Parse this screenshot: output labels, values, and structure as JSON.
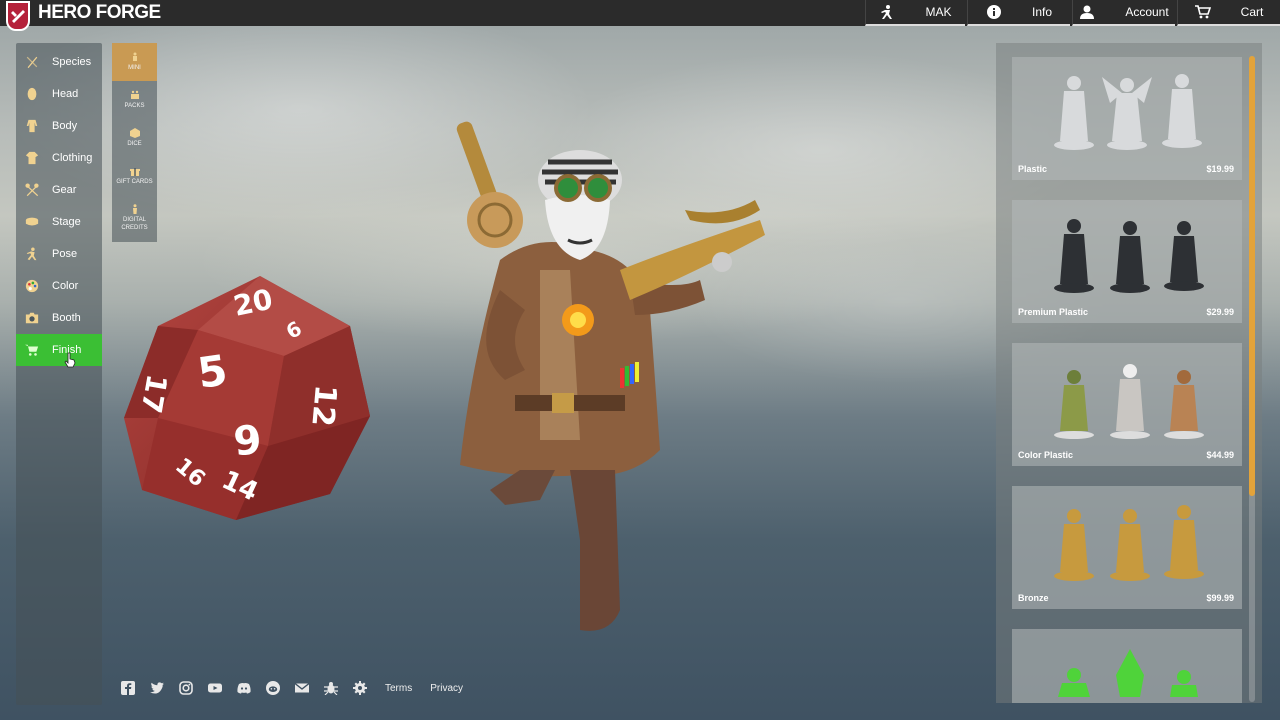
{
  "brand": {
    "name": "HERO FORGE",
    "logo_icon": "anvil-hammer-icon",
    "accent": "#b5213a"
  },
  "topnav": [
    {
      "label": "MAK",
      "icon": "hero-figure-icon"
    },
    {
      "label": "Info",
      "icon": "info-icon"
    },
    {
      "label": "Account",
      "icon": "user-icon"
    },
    {
      "label": "Cart",
      "icon": "cart-icon"
    }
  ],
  "sidebar": {
    "items": [
      {
        "label": "Species",
        "icon": "dna-icon"
      },
      {
        "label": "Head",
        "icon": "head-icon"
      },
      {
        "label": "Body",
        "icon": "body-icon"
      },
      {
        "label": "Clothing",
        "icon": "shirt-icon"
      },
      {
        "label": "Gear",
        "icon": "crossed-axes-icon"
      },
      {
        "label": "Stage",
        "icon": "stage-base-icon"
      },
      {
        "label": "Pose",
        "icon": "running-pose-icon"
      },
      {
        "label": "Color",
        "icon": "palette-icon"
      },
      {
        "label": "Booth",
        "icon": "camera-icon"
      },
      {
        "label": "Finish",
        "icon": "cart-icon",
        "active": true
      }
    ],
    "active_color": "#3bbf34"
  },
  "product_types": [
    {
      "label": "MINI",
      "icon": "mini-figure-icon",
      "active": true
    },
    {
      "label": "PACKS",
      "icon": "packs-icon"
    },
    {
      "label": "DICE",
      "icon": "dice-icon"
    },
    {
      "label": "GIFT CARDS",
      "icon": "gift-icon"
    },
    {
      "label": "DIGITAL CREDITS",
      "icon": "digital-figure-icon"
    }
  ],
  "d20": {
    "faces": [
      "20",
      "5",
      "9",
      "12",
      "17",
      "6",
      "16",
      "14"
    ],
    "color": "#9b2f2c"
  },
  "finishes": [
    {
      "name": "Plastic",
      "price": "$19.99",
      "mini_color": "#d2d4d6"
    },
    {
      "name": "Premium Plastic",
      "price": "$29.99",
      "mini_color": "#2c2f33"
    },
    {
      "name": "Color Plastic",
      "price": "$44.99",
      "mini_color": "#8c9a48"
    },
    {
      "name": "Bronze",
      "price": "$99.99",
      "mini_color": "#c79a3e"
    },
    {
      "name": "",
      "price": "",
      "mini_color": "#4fd33a"
    }
  ],
  "footer": {
    "icons": [
      "facebook-icon",
      "twitter-icon",
      "instagram-icon",
      "youtube-icon",
      "discord-icon",
      "reddit-icon",
      "mail-icon",
      "bug-icon",
      "settings-icon"
    ],
    "links": [
      "Terms",
      "Privacy"
    ]
  }
}
